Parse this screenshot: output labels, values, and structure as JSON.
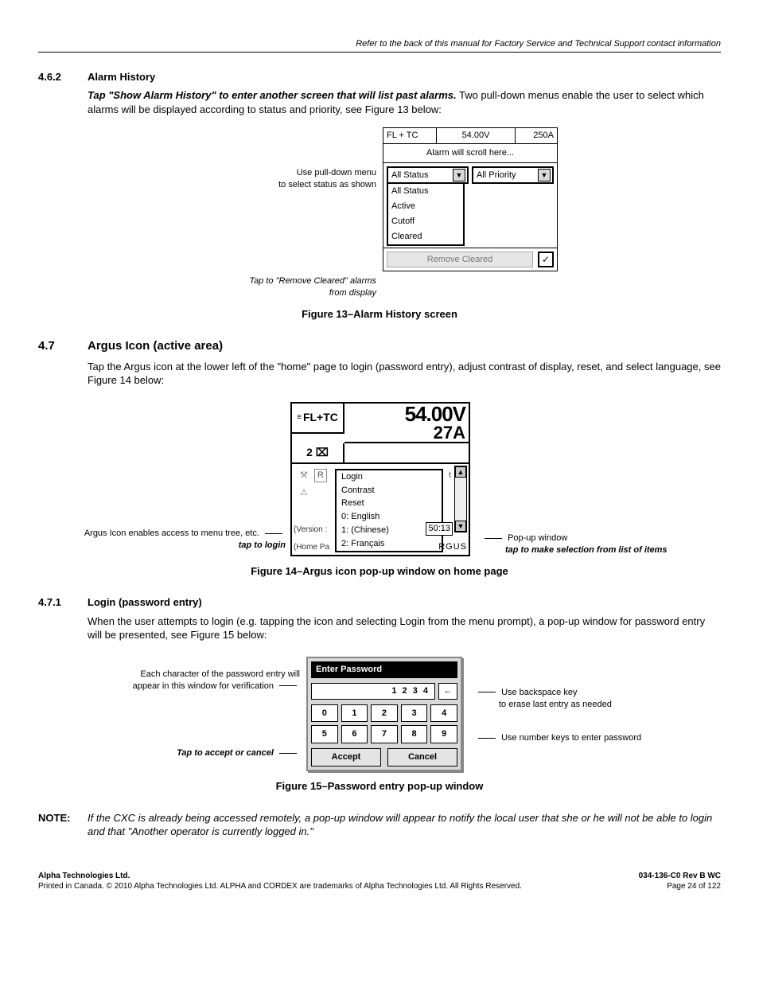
{
  "header_note": "Refer to the back of this manual for Factory Service and Technical Support contact information",
  "s462": {
    "num": "4.6.2",
    "title": "Alarm History",
    "lead_bold": "Tap \"Show Alarm History\" to enter another screen that will list past alarms.",
    "lead_rest": " Two pull-down menus enable the user to select which alarms will be displayed according to status and priority, see Figure 13 below:"
  },
  "fig13": {
    "left1a": "Use pull-down menu",
    "left1b": "to select status as shown",
    "left2a": "Tap to \"Remove Cleared\" alarms",
    "left2b": "from display",
    "top_mode": "FL + TC",
    "top_v": "54.00V",
    "top_a": "250A",
    "scroll": "Alarm will scroll here...",
    "status_sel": "All Status",
    "priority_sel": "All Priority",
    "status_opts": [
      "All Status",
      "Active",
      "Cutoff",
      "Cleared"
    ],
    "remove": "Remove Cleared",
    "caption": "Figure 13–Alarm History screen"
  },
  "s47": {
    "num": "4.7",
    "title": "Argus Icon (active area)",
    "body": "Tap the Argus icon at the lower left of the \"home\" page to login (password entry), adjust contrast of display, reset, and select language, see Figure 14 below:"
  },
  "fig14": {
    "left1": "Argus Icon enables access to menu tree, etc.",
    "left2": "tap to login",
    "right1": "Pop-up window",
    "right2": "tap to make selection from list of items",
    "mode": "FL+TC",
    "voltage": "54.00V",
    "current": "27A",
    "sub_left": "2 ⌧",
    "popup": [
      "Login",
      "Contrast",
      "Reset",
      "0: English",
      "1: (Chinese)",
      "2: Français"
    ],
    "version": "(Version :",
    "home": "(Home Pa",
    "time": "50:13",
    "brand": "RGUS",
    "bg_r": "R",
    "bg_t": "t",
    "caption": "Figure 14–Argus icon pop-up window on home page"
  },
  "s471": {
    "num": "4.7.1",
    "title": "Login (password entry)",
    "body": "When the user attempts to login (e.g. tapping the icon and selecting Login from the menu prompt), a pop-up window for password entry will be presented, see Figure 15 below:"
  },
  "fig15": {
    "left1a": "Each character of the password entry will",
    "left1b": "appear in this window for verification",
    "left2": "Tap to accept or cancel",
    "right1a": "Use backspace key",
    "right1b": "to erase last entry as needed",
    "right2": "Use number keys to enter password",
    "title": "Enter Password",
    "entry": "1 2 3 4",
    "back": "←",
    "keys": [
      "0",
      "1",
      "2",
      "3",
      "4",
      "5",
      "6",
      "7",
      "8",
      "9"
    ],
    "accept": "Accept",
    "cancel": "Cancel",
    "caption": "Figure 15–Password entry pop-up window"
  },
  "note": {
    "label": "NOTE:",
    "text": "If the CXC is already being accessed remotely, a pop-up window will appear to notify the local user that she or he will not be able to login and that \"Another operator is currently logged in.\""
  },
  "footer": {
    "l1": "Alpha Technologies Ltd.",
    "l2": "Printed in Canada.  © 2010 Alpha Technologies Ltd.  ALPHA and CORDEX are trademarks of Alpha Technologies Ltd.  All Rights Reserved.",
    "r1": "034-136-C0  Rev B  WC",
    "r2": "Page 24 of 122"
  }
}
